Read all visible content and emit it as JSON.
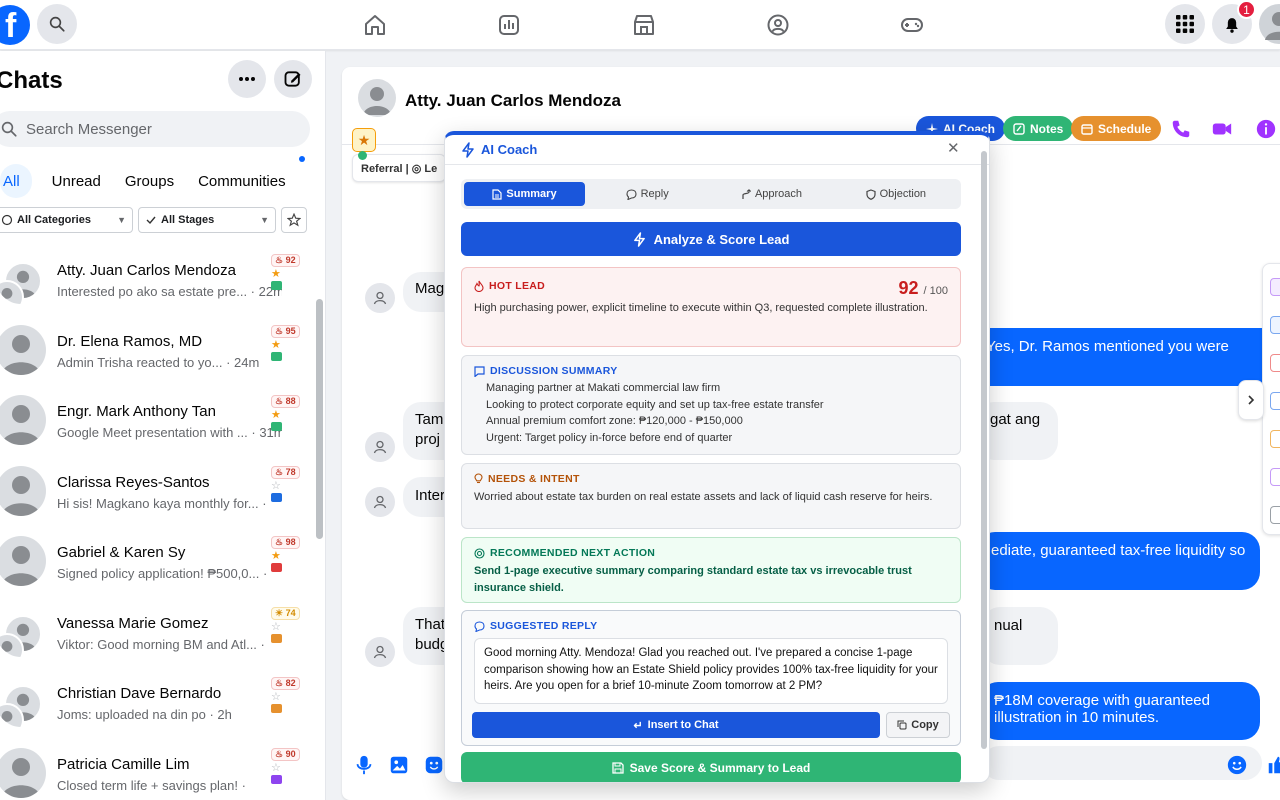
{
  "topbar": {
    "logo": "f"
  },
  "sidebar": {
    "title": "Chats",
    "search_placeholder": "Search Messenger",
    "tabs": [
      "All",
      "Unread",
      "Groups",
      "Communities"
    ],
    "filters": {
      "category": "All Categories",
      "stage": "All Stages"
    },
    "chats": [
      {
        "name": "Atty. Juan Carlos Mendoza",
        "preview": "Interested po ako sa estate pre... · 22m",
        "score": "92",
        "starred": true,
        "stage_color": "#2fb575",
        "group": true
      },
      {
        "name": "Dr. Elena Ramos, MD",
        "preview": "Admin Trisha reacted  to yo... · 24m",
        "score": "95",
        "starred": true,
        "stage_color": "#2fb575",
        "group": false
      },
      {
        "name": "Engr. Mark Anthony Tan",
        "preview": "Google Meet presentation with ... · 31m",
        "score": "88",
        "starred": true,
        "stage_color": "#2fb575",
        "group": false
      },
      {
        "name": "Clarissa Reyes-Santos",
        "preview": "Hi sis! Magkano kaya monthly for... ·",
        "score": "78",
        "starred": false,
        "stage_color": "#1d6ce0",
        "group": false
      },
      {
        "name": "Gabriel & Karen Sy",
        "preview": "Signed policy application! ₱500,0... ·",
        "score": "98",
        "starred": true,
        "stage_color": "#e03c3c",
        "group": false
      },
      {
        "name": "Vanessa Marie Gomez",
        "preview": "Viktor: Good morning BM and Atl... ·",
        "score": "74",
        "starred": false,
        "stage_color": "#e6912e",
        "group": true
      },
      {
        "name": "Christian Dave Bernardo",
        "preview": "Joms: uploaded na din po  · 2h",
        "score": "82",
        "starred": false,
        "stage_color": "#e6912e",
        "group": true
      },
      {
        "name": "Patricia Camille Lim",
        "preview": "Closed term life + savings plan! ·",
        "score": "90",
        "starred": false,
        "stage_color": "#8e44ef",
        "group": false
      }
    ]
  },
  "conversation": {
    "contact_name": "Atty. Juan Carlos Mendoza",
    "referral_tag": "Referral | ◎ Le",
    "actions": {
      "ai_coach": "AI Coach",
      "notes": "Notes",
      "schedule": "Schedule"
    },
    "messages": [
      {
        "dir": "in",
        "text": "Mag"
      },
      {
        "dir": "out",
        "text": "Yes, Dr. Ramos mentioned you were"
      },
      {
        "dir": "in",
        "text": "Tam proj"
      },
      {
        "dir": "out_light",
        "text": "gat ang"
      },
      {
        "dir": "in",
        "text": "Inter"
      },
      {
        "dir": "out",
        "text": "ediate, guaranteed tax-free liquidity so"
      },
      {
        "dir": "in",
        "text": "That budg"
      },
      {
        "dir": "out_light",
        "text": "nual"
      },
      {
        "dir": "out",
        "text": "₱18M coverage with guaranteed illustration in 10 minutes."
      }
    ]
  },
  "ai_coach": {
    "title": "AI Coach",
    "tabs": [
      "Summary",
      "Reply",
      "Approach",
      "Objection"
    ],
    "analyze_label": "Analyze & Score Lead",
    "hot_lead": {
      "label": "HOT LEAD",
      "score": "92",
      "max": "/ 100",
      "text": "High purchasing power, explicit timeline to execute within Q3, requested complete illustration."
    },
    "discussion": {
      "label": "DISCUSSION SUMMARY",
      "items": [
        "Managing partner at Makati commercial law firm",
        "Looking to protect corporate equity and set up tax-free estate transfer",
        "Annual premium comfort zone: ₱120,000 - ₱150,000",
        "Urgent: Target policy in-force before end of quarter"
      ]
    },
    "needs": {
      "label": "NEEDS & INTENT",
      "text": "Worried about estate tax burden on real estate assets and lack of liquid cash reserve for heirs."
    },
    "next_action": {
      "label": "RECOMMENDED NEXT ACTION",
      "text": "Send 1-page executive summary comparing standard estate tax vs irrevocable trust insurance shield."
    },
    "suggested_reply": {
      "label": "SUGGESTED REPLY",
      "text": "Good morning Atty. Mendoza! Glad you reached out. I've prepared a concise 1-page comparison showing how an Estate Shield policy provides 100% tax-free liquidity for your heirs. Are you open for a brief 10-minute Zoom tomorrow at 2 PM?",
      "insert_label": "Insert to Chat",
      "copy_label": "Copy"
    },
    "save_label": "Save Score & Summary to Lead"
  },
  "notifications": {
    "count": "1"
  },
  "colors": {
    "brand": "#0866ff",
    "coach_blue": "#1a56db",
    "hot_red": "#c81e1e",
    "save_green": "#2fb575"
  }
}
